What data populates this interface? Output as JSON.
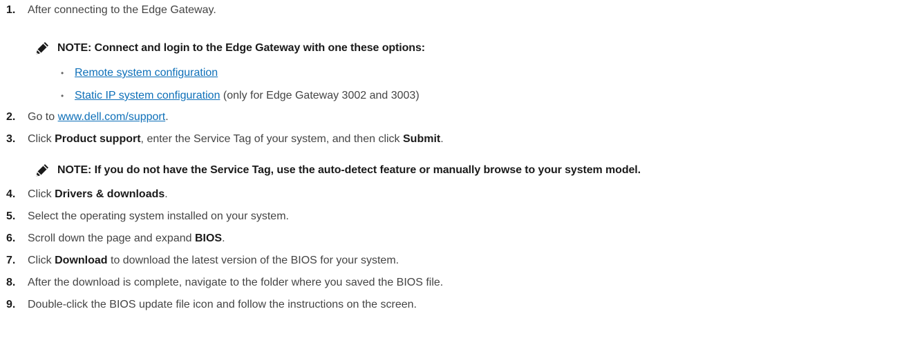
{
  "steps": [
    {
      "num": "1.",
      "text": "After connecting to the Edge Gateway."
    },
    {
      "num": "2.",
      "pre": "Go to ",
      "link": "www.dell.com/support",
      "post": "."
    },
    {
      "num": "3.",
      "pre": "Click ",
      "bold1": "Product support",
      "mid": ", enter the Service Tag of your system, and then click ",
      "bold2": "Submit",
      "post": "."
    },
    {
      "num": "4.",
      "pre": "Click ",
      "bold": "Drivers & downloads",
      "post": "."
    },
    {
      "num": "5.",
      "text": "Select the operating system installed on your system."
    },
    {
      "num": "6.",
      "pre": "Scroll down the page and expand ",
      "bold": "BIOS",
      "post": "."
    },
    {
      "num": "7.",
      "pre": "Click ",
      "bold": "Download",
      "post": " to download the latest version of the BIOS for your system."
    },
    {
      "num": "8.",
      "text": "After the download is complete, navigate to the folder where you saved the BIOS file."
    },
    {
      "num": "9.",
      "text": "Double-click the BIOS update file icon and follow the instructions on the screen."
    }
  ],
  "notes": [
    {
      "text": "NOTE: Connect and login to the Edge Gateway with one these options:"
    },
    {
      "text": "NOTE: If you do not have the Service Tag, use the auto-detect feature or manually browse to your system model."
    }
  ],
  "bullets": [
    {
      "link": "Remote system configuration",
      "post": ""
    },
    {
      "link": "Static IP system configuration",
      "post": " (only for Edge Gateway 3002 and 3003)"
    }
  ],
  "bullet_char": "•",
  "colors": {
    "link": "#0d6fb8",
    "text": "#444444",
    "bold": "#1a1a1a"
  },
  "icons": {
    "note": "pencil-icon"
  }
}
